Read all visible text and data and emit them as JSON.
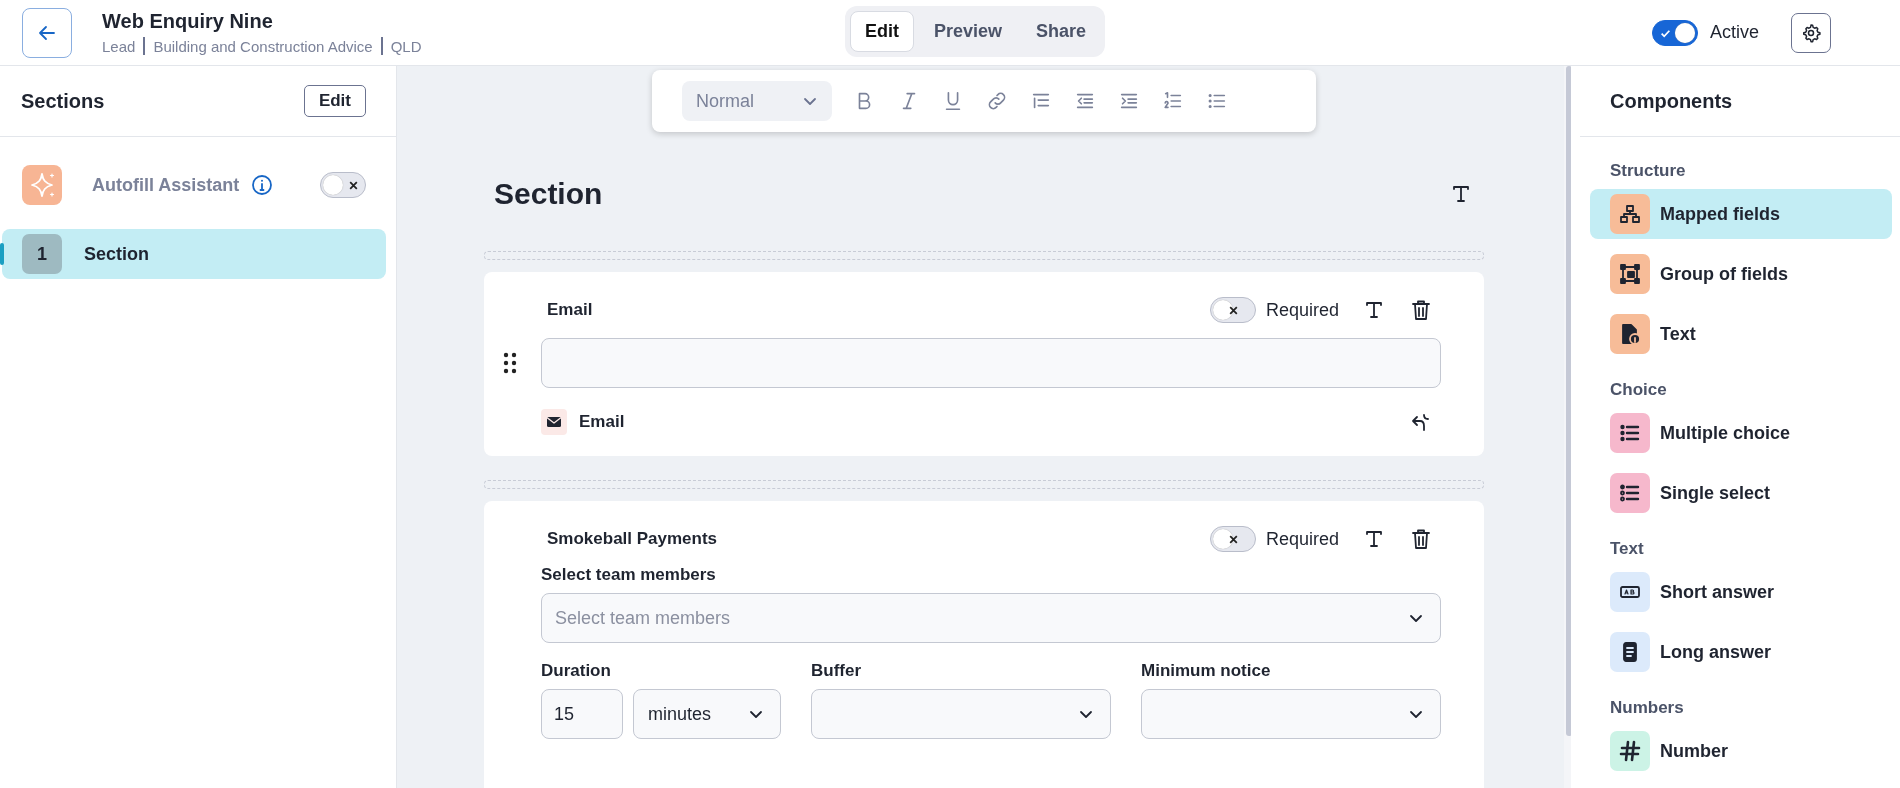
{
  "header": {
    "title": "Web Enquiry Nine",
    "subtitle": [
      "Lead",
      "Building and Construction Advice",
      "QLD"
    ],
    "tabs": [
      {
        "label": "Edit",
        "selected": true
      },
      {
        "label": "Preview",
        "selected": false
      },
      {
        "label": "Share",
        "selected": false
      }
    ],
    "active_toggle": {
      "label": "Active",
      "on": true
    }
  },
  "sidebar": {
    "title": "Sections",
    "edit_button": "Edit",
    "autofill": {
      "label": "Autofill Assistant",
      "on": false
    },
    "sections": [
      {
        "number": "1",
        "label": "Section",
        "selected": true
      }
    ]
  },
  "editor": {
    "style_select": "Normal",
    "section_title": "Section",
    "fields": [
      {
        "kind": "email",
        "label": "Email",
        "required": false,
        "required_label": "Required",
        "mapping": "Email"
      },
      {
        "kind": "payments",
        "label": "Smokeball Payments",
        "required": false,
        "required_label": "Required",
        "team_label": "Select team members",
        "team_placeholder": "Select team members",
        "duration_label": "Duration",
        "duration_value": "15",
        "duration_unit": "minutes",
        "buffer_label": "Buffer",
        "notice_label": "Minimum notice"
      }
    ]
  },
  "components": {
    "title": "Components",
    "groups": [
      {
        "title": "Structure",
        "items": [
          {
            "kind": "mapped",
            "label": "Mapped fields",
            "color": "#f7bc98",
            "selected": true
          },
          {
            "kind": "group",
            "label": "Group of fields",
            "color": "#f7bc98",
            "selected": false
          },
          {
            "kind": "text",
            "label": "Text",
            "color": "#f7bc98",
            "selected": false
          }
        ]
      },
      {
        "title": "Choice",
        "items": [
          {
            "kind": "multi",
            "label": "Multiple choice",
            "color": "#f6b8cc",
            "selected": false
          },
          {
            "kind": "single",
            "label": "Single select",
            "color": "#f6b8cc",
            "selected": false
          }
        ]
      },
      {
        "title": "Text",
        "items": [
          {
            "kind": "short",
            "label": "Short answer",
            "color": "#dceafb",
            "selected": false
          },
          {
            "kind": "long",
            "label": "Long answer",
            "color": "#dceafb",
            "selected": false
          }
        ]
      },
      {
        "title": "Numbers",
        "items": [
          {
            "kind": "number",
            "label": "Number",
            "color": "#ccf3e6",
            "selected": false
          }
        ]
      }
    ]
  }
}
